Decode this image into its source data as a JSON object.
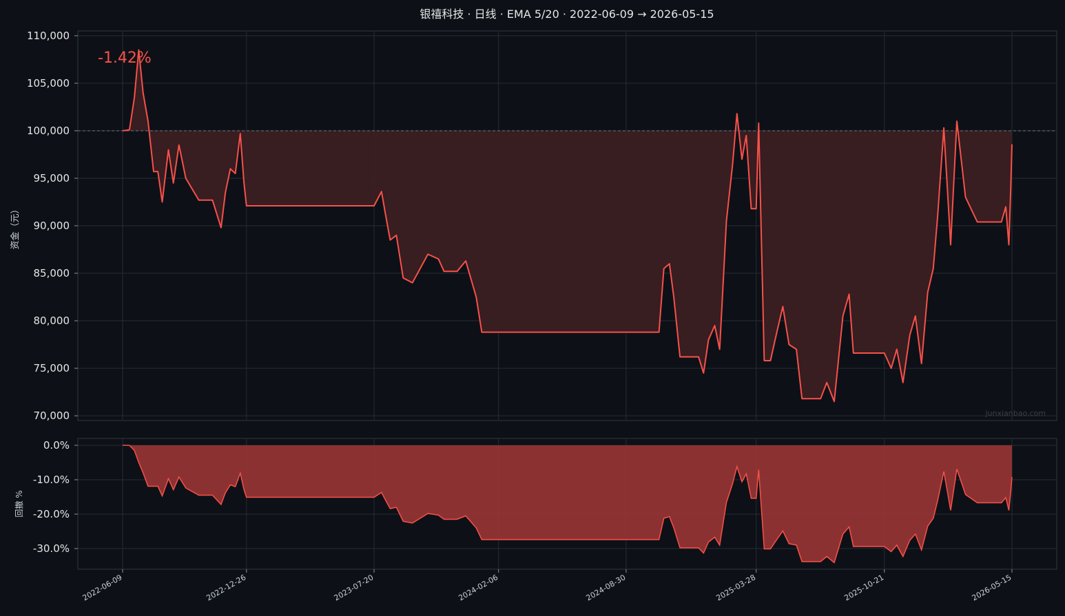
{
  "colors": {
    "background": "#0d1117",
    "panel": "#0d1117",
    "grid": "#262b33",
    "line": "#f85149",
    "equity_fill": "#3b1f22",
    "drawdown_fill": "#9a3535",
    "baseline": "#6e7681",
    "text": "#e6e6e6"
  },
  "title": "银禧科技 · 日线 · EMA 5/20 · 2022-06-09 → 2026-05-15",
  "return_label": "-1.42%",
  "watermark": "junxianbao.com",
  "chart_data": [
    {
      "type": "area",
      "name": "equity",
      "ylabel": "资金（元）",
      "ylim": [
        69500,
        110500
      ],
      "yticks": [
        70000,
        75000,
        80000,
        85000,
        90000,
        95000,
        100000,
        105000,
        110000
      ],
      "ytick_labels": [
        "70,000",
        "75,000",
        "80,000",
        "85,000",
        "90,000",
        "95,000",
        "100,000",
        "105,000",
        "110,000"
      ],
      "baseline": 100000,
      "grid": true,
      "x": [
        "2022-06-09",
        "2022-06-20",
        "2022-06-28",
        "2022-07-05",
        "2022-07-12",
        "2022-07-20",
        "2022-07-29",
        "2022-08-05",
        "2022-08-12",
        "2022-08-22",
        "2022-08-30",
        "2022-09-08",
        "2022-09-19",
        "2022-10-10",
        "2022-10-20",
        "2022-11-01",
        "2022-11-15",
        "2022-11-22",
        "2022-11-30",
        "2022-12-08",
        "2022-12-16",
        "2022-12-22",
        "2022-12-26",
        "2023-01-05",
        "2023-01-16",
        "2023-02-01",
        "2023-03-01",
        "2023-05-01",
        "2023-07-20",
        "2023-08-01",
        "2023-08-08",
        "2023-08-15",
        "2023-08-25",
        "2023-09-05",
        "2023-09-20",
        "2023-10-15",
        "2023-11-01",
        "2023-11-10",
        "2023-11-20",
        "2023-12-01",
        "2023-12-15",
        "2024-01-01",
        "2024-01-10",
        "2024-01-25",
        "2024-02-06",
        "2024-02-20",
        "2024-03-15",
        "2024-05-01",
        "2024-07-01",
        "2024-08-30",
        "2024-10-01",
        "2024-10-22",
        "2024-10-30",
        "2024-11-08",
        "2024-11-15",
        "2024-11-25",
        "2024-12-10",
        "2024-12-25",
        "2025-01-02",
        "2025-01-10",
        "2025-01-20",
        "2025-01-28",
        "2025-02-08",
        "2025-02-18",
        "2025-02-25",
        "2025-03-05",
        "2025-03-12",
        "2025-03-20",
        "2025-03-28",
        "2025-04-01",
        "2025-04-10",
        "2025-04-20",
        "2025-05-01",
        "2025-05-10",
        "2025-05-20",
        "2025-06-01",
        "2025-06-10",
        "2025-06-20",
        "2025-07-01",
        "2025-07-10",
        "2025-07-20",
        "2025-08-01",
        "2025-08-15",
        "2025-08-25",
        "2025-09-01",
        "2025-09-15",
        "2025-10-01",
        "2025-10-15",
        "2025-10-21",
        "2025-11-01",
        "2025-11-10",
        "2025-11-20",
        "2025-12-01",
        "2025-12-10",
        "2025-12-20",
        "2025-12-30",
        "2026-01-08",
        "2026-01-15",
        "2026-01-25",
        "2026-02-05",
        "2026-02-15",
        "2026-03-01",
        "2026-03-20",
        "2026-04-10",
        "2026-04-20",
        "2026-04-28",
        "2026-05-05",
        "2026-05-10",
        "2026-05-13",
        "2026-05-15"
      ],
      "values": [
        100000,
        100100,
        103500,
        108500,
        104000,
        101000,
        95700,
        95700,
        92500,
        98000,
        94500,
        98500,
        95000,
        92700,
        92700,
        92700,
        89800,
        93500,
        96000,
        95500,
        99700,
        94500,
        92100,
        92100,
        92100,
        92100,
        92100,
        92100,
        92100,
        93600,
        91000,
        88500,
        89000,
        84500,
        84000,
        87000,
        86500,
        85200,
        85200,
        85200,
        86300,
        82500,
        78800,
        78800,
        78800,
        78800,
        78800,
        78800,
        78800,
        78800,
        78800,
        78800,
        85500,
        86000,
        82500,
        76200,
        76200,
        76200,
        74500,
        78000,
        79500,
        77000,
        90500,
        96500,
        101800,
        97000,
        99500,
        91800,
        91800,
        100800,
        75800,
        75800,
        79000,
        81500,
        77500,
        77000,
        71800,
        71800,
        71800,
        71800,
        73500,
        71500,
        80500,
        82800,
        76600,
        76600,
        76600,
        76600,
        76600,
        75000,
        77000,
        73500,
        78500,
        80500,
        75500,
        83000,
        85500,
        91000,
        100300,
        88000,
        101000,
        93000,
        90400,
        90400,
        90400,
        90400,
        92000,
        88000,
        93800,
        98580
      ]
    },
    {
      "type": "area",
      "name": "drawdown",
      "ylabel": "回撤 %",
      "ylim": [
        -36,
        2
      ],
      "yticks": [
        0,
        -10,
        -20,
        -30
      ],
      "ytick_labels": [
        "0.0%",
        "-10.0%",
        "-20.0%",
        "-30.0%"
      ],
      "grid": true,
      "x": [
        "2022-06-09",
        "2022-06-20",
        "2022-06-28",
        "2022-07-05",
        "2022-07-12",
        "2022-07-20",
        "2022-07-29",
        "2022-08-05",
        "2022-08-12",
        "2022-08-22",
        "2022-08-30",
        "2022-09-08",
        "2022-09-19",
        "2022-10-10",
        "2022-10-20",
        "2022-11-01",
        "2022-11-15",
        "2022-11-22",
        "2022-11-30",
        "2022-12-08",
        "2022-12-16",
        "2022-12-22",
        "2022-12-26",
        "2023-01-05",
        "2023-01-16",
        "2023-02-01",
        "2023-03-01",
        "2023-05-01",
        "2023-07-20",
        "2023-08-01",
        "2023-08-08",
        "2023-08-15",
        "2023-08-25",
        "2023-09-05",
        "2023-09-20",
        "2023-10-15",
        "2023-11-01",
        "2023-11-10",
        "2023-11-20",
        "2023-12-01",
        "2023-12-15",
        "2024-01-01",
        "2024-01-10",
        "2024-01-25",
        "2024-02-06",
        "2024-02-20",
        "2024-03-15",
        "2024-05-01",
        "2024-07-01",
        "2024-08-30",
        "2024-10-01",
        "2024-10-22",
        "2024-10-30",
        "2024-11-08",
        "2024-11-15",
        "2024-11-25",
        "2024-12-10",
        "2024-12-25",
        "2025-01-02",
        "2025-01-10",
        "2025-01-20",
        "2025-01-28",
        "2025-02-08",
        "2025-02-18",
        "2025-02-25",
        "2025-03-05",
        "2025-03-12",
        "2025-03-20",
        "2025-03-28",
        "2025-04-01",
        "2025-04-10",
        "2025-04-20",
        "2025-05-01",
        "2025-05-10",
        "2025-05-20",
        "2025-06-01",
        "2025-06-10",
        "2025-06-20",
        "2025-07-01",
        "2025-07-10",
        "2025-07-20",
        "2025-08-01",
        "2025-08-15",
        "2025-08-25",
        "2025-09-01",
        "2025-09-15",
        "2025-10-01",
        "2025-10-15",
        "2025-10-21",
        "2025-11-01",
        "2025-11-10",
        "2025-11-20",
        "2025-12-01",
        "2025-12-10",
        "2025-12-20",
        "2025-12-30",
        "2026-01-08",
        "2026-01-15",
        "2026-01-25",
        "2026-02-05",
        "2026-02-15",
        "2026-03-01",
        "2026-03-20",
        "2026-04-10",
        "2026-04-20",
        "2026-04-28",
        "2026-05-05",
        "2026-05-10",
        "2026-05-13",
        "2026-05-15"
      ],
      "values": [
        0,
        0,
        -1.5,
        -5,
        -8,
        -11.9,
        -11.9,
        -11.9,
        -14.7,
        -9.7,
        -12.9,
        -9.2,
        -12.4,
        -14.5,
        -14.5,
        -14.5,
        -17.2,
        -13.8,
        -11.5,
        -12,
        -8.1,
        -12.9,
        -15.1,
        -15.1,
        -15.1,
        -15.1,
        -15.1,
        -15.1,
        -15.1,
        -13.7,
        -16.1,
        -18.4,
        -18,
        -22.1,
        -22.6,
        -19.8,
        -20.3,
        -21.5,
        -21.5,
        -21.5,
        -20.5,
        -24,
        -27.4,
        -27.4,
        -27.4,
        -27.4,
        -27.4,
        -27.4,
        -27.4,
        -27.4,
        -27.4,
        -27.4,
        -21.2,
        -20.7,
        -24,
        -29.8,
        -29.8,
        -29.8,
        -31.3,
        -28.1,
        -26.7,
        -29,
        -16.6,
        -11.1,
        -6.2,
        -10.6,
        -8.3,
        -15.4,
        -15.4,
        -7.1,
        -30.1,
        -30.1,
        -27.2,
        -24.9,
        -28.6,
        -29,
        -33.8,
        -33.8,
        -33.8,
        -33.8,
        -32.3,
        -34.1,
        -25.8,
        -23.7,
        -29.4,
        -29.4,
        -29.4,
        -29.4,
        -29.4,
        -30.9,
        -29,
        -32.3,
        -27.6,
        -25.8,
        -30.4,
        -23.5,
        -21.2,
        -16.1,
        -7.6,
        -18.9,
        -6.9,
        -14.3,
        -16.7,
        -16.7,
        -16.7,
        -16.7,
        -15.2,
        -18.9,
        -13.6,
        -9.2
      ]
    }
  ],
  "x_axis": {
    "ticks": [
      "2022-06-09",
      "2022-12-26",
      "2023-07-20",
      "2024-02-06",
      "2024-08-30",
      "2025-03-28",
      "2025-10-21",
      "2026-05-15"
    ],
    "range": [
      "2022-06-09",
      "2026-05-15"
    ]
  }
}
